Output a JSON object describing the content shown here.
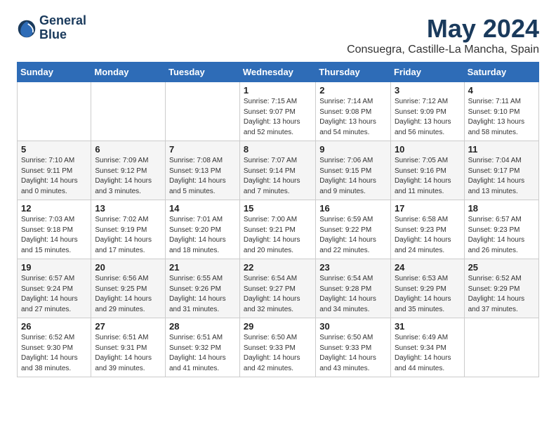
{
  "logo": {
    "line1": "General",
    "line2": "Blue"
  },
  "title": "May 2024",
  "subtitle": "Consuegra, Castille-La Mancha, Spain",
  "weekdays": [
    "Sunday",
    "Monday",
    "Tuesday",
    "Wednesday",
    "Thursday",
    "Friday",
    "Saturday"
  ],
  "weeks": [
    [
      {
        "num": "",
        "info": ""
      },
      {
        "num": "",
        "info": ""
      },
      {
        "num": "",
        "info": ""
      },
      {
        "num": "1",
        "info": "Sunrise: 7:15 AM\nSunset: 9:07 PM\nDaylight: 13 hours\nand 52 minutes."
      },
      {
        "num": "2",
        "info": "Sunrise: 7:14 AM\nSunset: 9:08 PM\nDaylight: 13 hours\nand 54 minutes."
      },
      {
        "num": "3",
        "info": "Sunrise: 7:12 AM\nSunset: 9:09 PM\nDaylight: 13 hours\nand 56 minutes."
      },
      {
        "num": "4",
        "info": "Sunrise: 7:11 AM\nSunset: 9:10 PM\nDaylight: 13 hours\nand 58 minutes."
      }
    ],
    [
      {
        "num": "5",
        "info": "Sunrise: 7:10 AM\nSunset: 9:11 PM\nDaylight: 14 hours\nand 0 minutes."
      },
      {
        "num": "6",
        "info": "Sunrise: 7:09 AM\nSunset: 9:12 PM\nDaylight: 14 hours\nand 3 minutes."
      },
      {
        "num": "7",
        "info": "Sunrise: 7:08 AM\nSunset: 9:13 PM\nDaylight: 14 hours\nand 5 minutes."
      },
      {
        "num": "8",
        "info": "Sunrise: 7:07 AM\nSunset: 9:14 PM\nDaylight: 14 hours\nand 7 minutes."
      },
      {
        "num": "9",
        "info": "Sunrise: 7:06 AM\nSunset: 9:15 PM\nDaylight: 14 hours\nand 9 minutes."
      },
      {
        "num": "10",
        "info": "Sunrise: 7:05 AM\nSunset: 9:16 PM\nDaylight: 14 hours\nand 11 minutes."
      },
      {
        "num": "11",
        "info": "Sunrise: 7:04 AM\nSunset: 9:17 PM\nDaylight: 14 hours\nand 13 minutes."
      }
    ],
    [
      {
        "num": "12",
        "info": "Sunrise: 7:03 AM\nSunset: 9:18 PM\nDaylight: 14 hours\nand 15 minutes."
      },
      {
        "num": "13",
        "info": "Sunrise: 7:02 AM\nSunset: 9:19 PM\nDaylight: 14 hours\nand 17 minutes."
      },
      {
        "num": "14",
        "info": "Sunrise: 7:01 AM\nSunset: 9:20 PM\nDaylight: 14 hours\nand 18 minutes."
      },
      {
        "num": "15",
        "info": "Sunrise: 7:00 AM\nSunset: 9:21 PM\nDaylight: 14 hours\nand 20 minutes."
      },
      {
        "num": "16",
        "info": "Sunrise: 6:59 AM\nSunset: 9:22 PM\nDaylight: 14 hours\nand 22 minutes."
      },
      {
        "num": "17",
        "info": "Sunrise: 6:58 AM\nSunset: 9:23 PM\nDaylight: 14 hours\nand 24 minutes."
      },
      {
        "num": "18",
        "info": "Sunrise: 6:57 AM\nSunset: 9:23 PM\nDaylight: 14 hours\nand 26 minutes."
      }
    ],
    [
      {
        "num": "19",
        "info": "Sunrise: 6:57 AM\nSunset: 9:24 PM\nDaylight: 14 hours\nand 27 minutes."
      },
      {
        "num": "20",
        "info": "Sunrise: 6:56 AM\nSunset: 9:25 PM\nDaylight: 14 hours\nand 29 minutes."
      },
      {
        "num": "21",
        "info": "Sunrise: 6:55 AM\nSunset: 9:26 PM\nDaylight: 14 hours\nand 31 minutes."
      },
      {
        "num": "22",
        "info": "Sunrise: 6:54 AM\nSunset: 9:27 PM\nDaylight: 14 hours\nand 32 minutes."
      },
      {
        "num": "23",
        "info": "Sunrise: 6:54 AM\nSunset: 9:28 PM\nDaylight: 14 hours\nand 34 minutes."
      },
      {
        "num": "24",
        "info": "Sunrise: 6:53 AM\nSunset: 9:29 PM\nDaylight: 14 hours\nand 35 minutes."
      },
      {
        "num": "25",
        "info": "Sunrise: 6:52 AM\nSunset: 9:29 PM\nDaylight: 14 hours\nand 37 minutes."
      }
    ],
    [
      {
        "num": "26",
        "info": "Sunrise: 6:52 AM\nSunset: 9:30 PM\nDaylight: 14 hours\nand 38 minutes."
      },
      {
        "num": "27",
        "info": "Sunrise: 6:51 AM\nSunset: 9:31 PM\nDaylight: 14 hours\nand 39 minutes."
      },
      {
        "num": "28",
        "info": "Sunrise: 6:51 AM\nSunset: 9:32 PM\nDaylight: 14 hours\nand 41 minutes."
      },
      {
        "num": "29",
        "info": "Sunrise: 6:50 AM\nSunset: 9:33 PM\nDaylight: 14 hours\nand 42 minutes."
      },
      {
        "num": "30",
        "info": "Sunrise: 6:50 AM\nSunset: 9:33 PM\nDaylight: 14 hours\nand 43 minutes."
      },
      {
        "num": "31",
        "info": "Sunrise: 6:49 AM\nSunset: 9:34 PM\nDaylight: 14 hours\nand 44 minutes."
      },
      {
        "num": "",
        "info": ""
      }
    ]
  ]
}
